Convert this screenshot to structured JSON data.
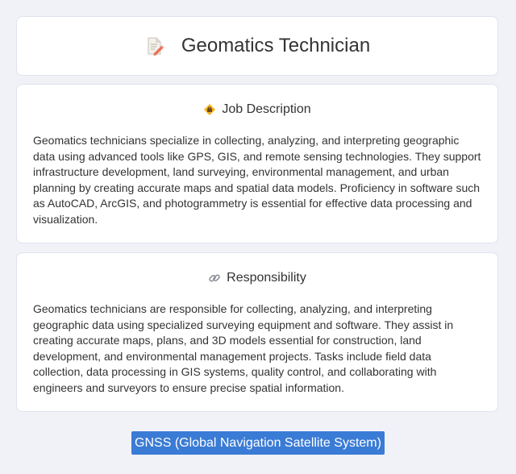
{
  "header": {
    "title": "Geomatics Technician",
    "icon": "document-pencil-icon"
  },
  "job_description": {
    "heading": "Job Description",
    "icon": "diamond-briefcase-icon",
    "body": "Geomatics technicians specialize in collecting, analyzing, and interpreting geographic data using advanced tools like GPS, GIS, and remote sensing technologies. They support infrastructure development, land surveying, environmental management, and urban planning by creating accurate maps and spatial data models. Proficiency in software such as AutoCAD, ArcGIS, and photogrammetry is essential for effective data processing and visualization."
  },
  "responsibility": {
    "heading": "Responsibility",
    "icon": "link-icon",
    "body": "Geomatics technicians are responsible for collecting, analyzing, and interpreting geographic data using specialized surveying equipment and software. They assist in creating accurate maps, plans, and 3D models essential for construction, land development, and environmental management projects. Tasks include field data collection, data processing in GIS systems, quality control, and collaborating with engineers and surveyors to ensure precise spatial information."
  },
  "tag": {
    "label": "GNSS (Global Navigation Satellite System)"
  },
  "colors": {
    "background": "#f0f2f8",
    "card": "#ffffff",
    "tag_bg": "#3a7bd5",
    "text": "#333333"
  }
}
